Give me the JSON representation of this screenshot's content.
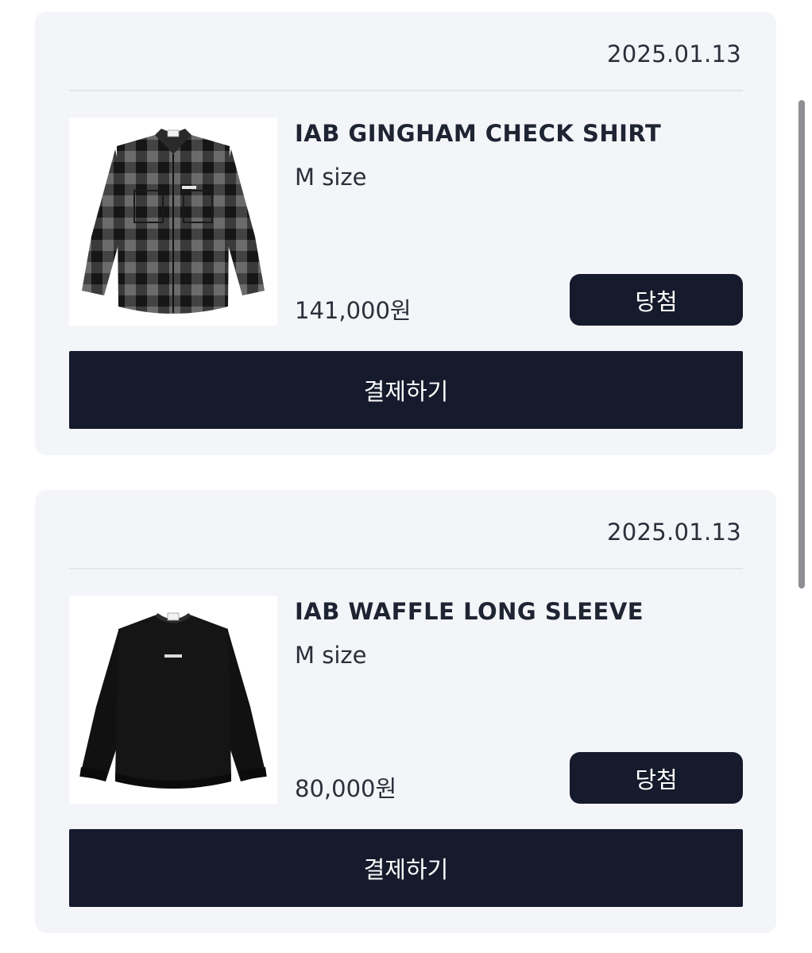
{
  "orders": [
    {
      "date": "2025.01.13",
      "product_name": "IAB GINGHAM CHECK SHIRT",
      "option": "M size",
      "price": "141,000원",
      "status_label": "당첨",
      "pay_label": "결제하기",
      "image_icon": "gingham-check-shirt-image"
    },
    {
      "date": "2025.01.13",
      "product_name": "IAB WAFFLE LONG SLEEVE",
      "option": "M size",
      "price": "80,000원",
      "status_label": "당첨",
      "pay_label": "결제하기",
      "image_icon": "waffle-long-sleeve-image"
    }
  ],
  "colors": {
    "card_background": "#f3f5f8",
    "button_background": "#151b2c",
    "button_text": "#ffffff",
    "divider": "#e2e5ea"
  }
}
